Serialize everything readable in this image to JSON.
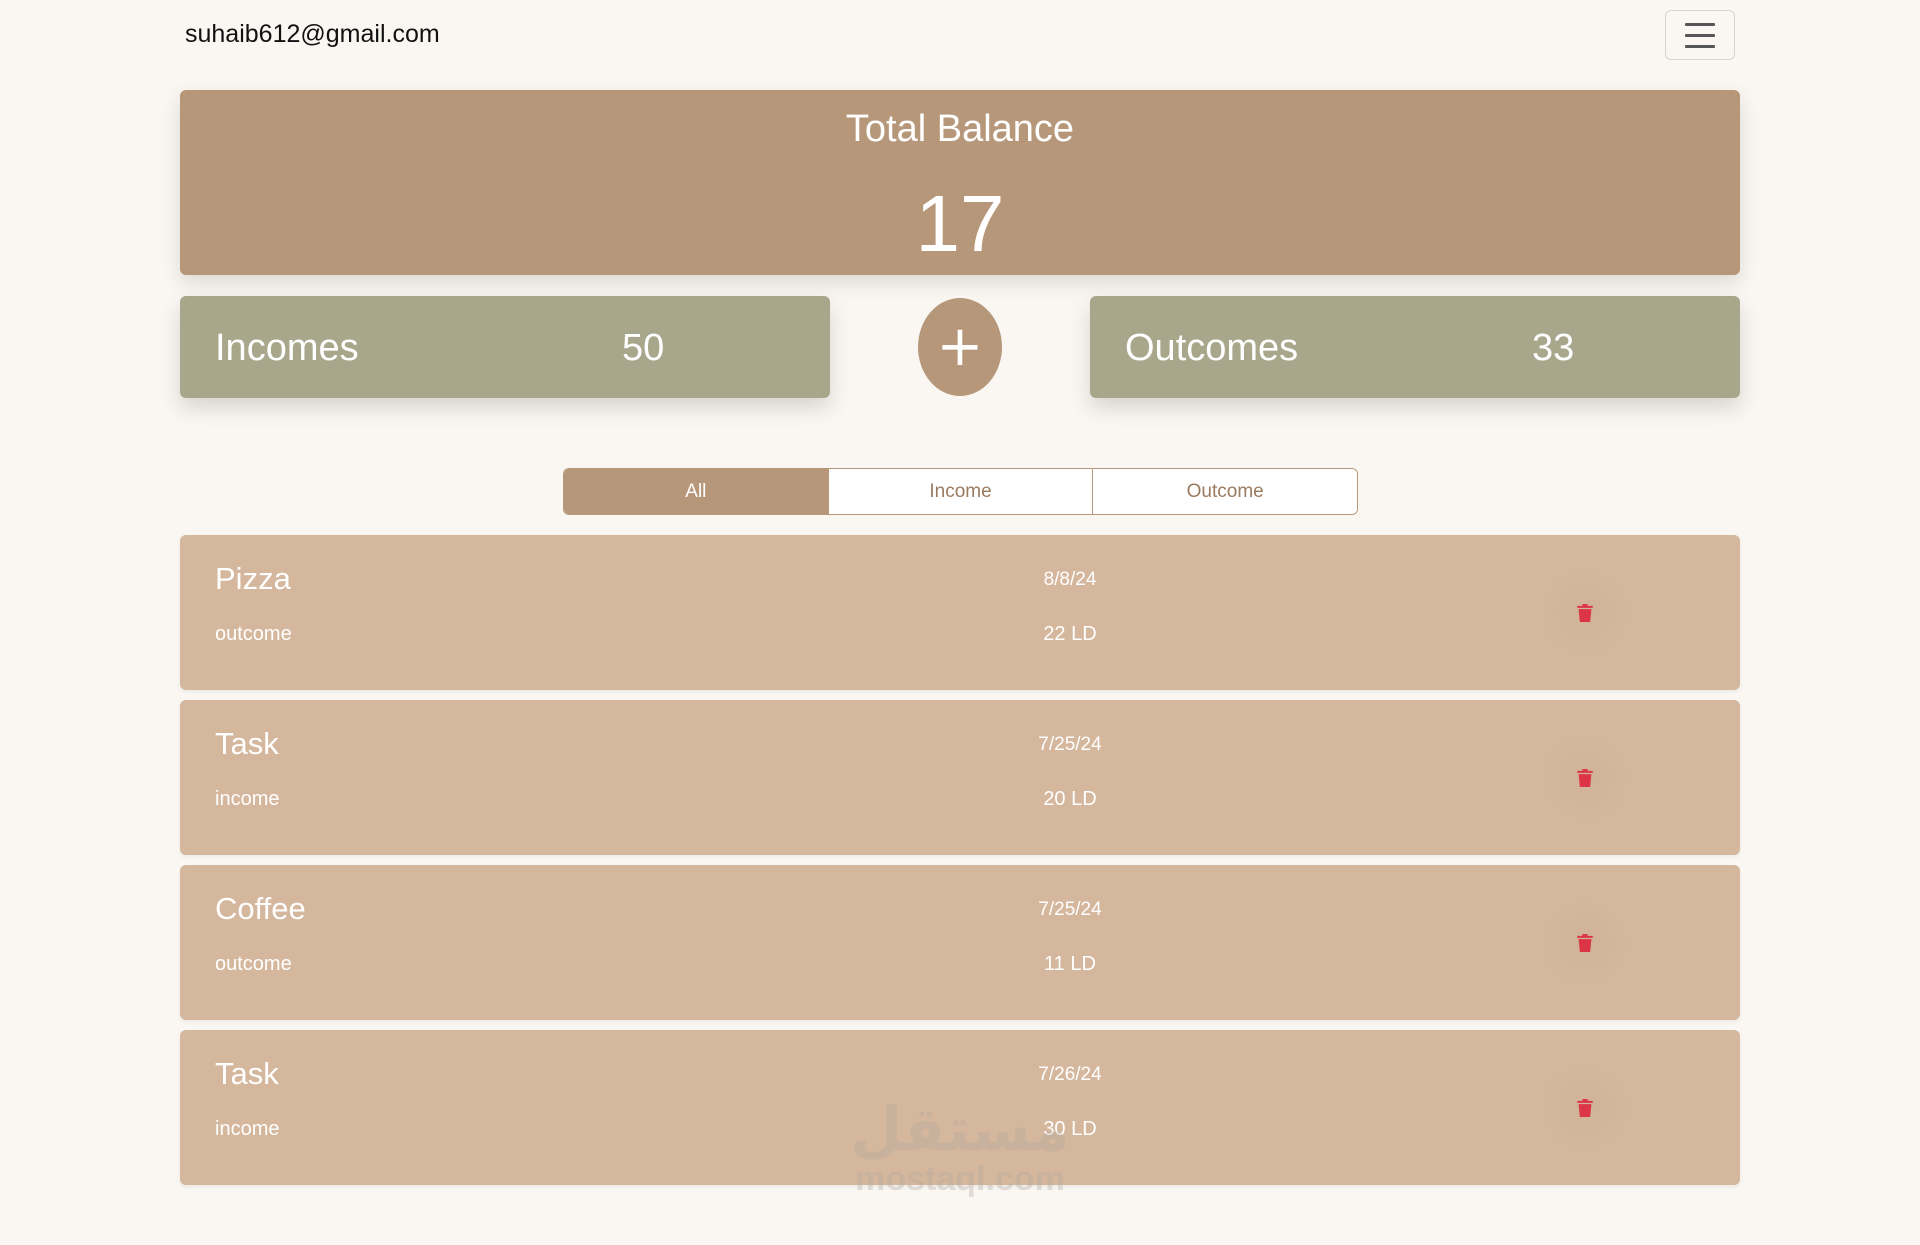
{
  "user": {
    "email": "suhaib612@gmail.com"
  },
  "nav": {
    "menu_icon": "hamburger-menu-icon"
  },
  "balance": {
    "title": "Total Balance",
    "value": "17"
  },
  "incomes": {
    "label": "Incomes",
    "value": "50"
  },
  "outcomes": {
    "label": "Outcomes",
    "value": "33"
  },
  "add_button": {
    "label": "+"
  },
  "filters": {
    "all": "All",
    "income": "Income",
    "outcome": "Outcome",
    "active": "All"
  },
  "transactions": [
    {
      "name": "Pizza",
      "type": "outcome",
      "date": "8/8/24",
      "amount": "22 LD"
    },
    {
      "name": "Task",
      "type": "income",
      "date": "7/25/24",
      "amount": "20 LD"
    },
    {
      "name": "Coffee",
      "type": "outcome",
      "date": "7/25/24",
      "amount": "11 LD"
    },
    {
      "name": "Task",
      "type": "income",
      "date": "7/26/24",
      "amount": "30 LD"
    }
  ],
  "watermark": {
    "arabic": "مستقل",
    "latin": "mostaql.com"
  },
  "colors": {
    "accent": "#b7977a",
    "stat": "#a8a78c",
    "row": "#d4b79c",
    "delete": "#dc3545",
    "background": "#faf7f2"
  }
}
